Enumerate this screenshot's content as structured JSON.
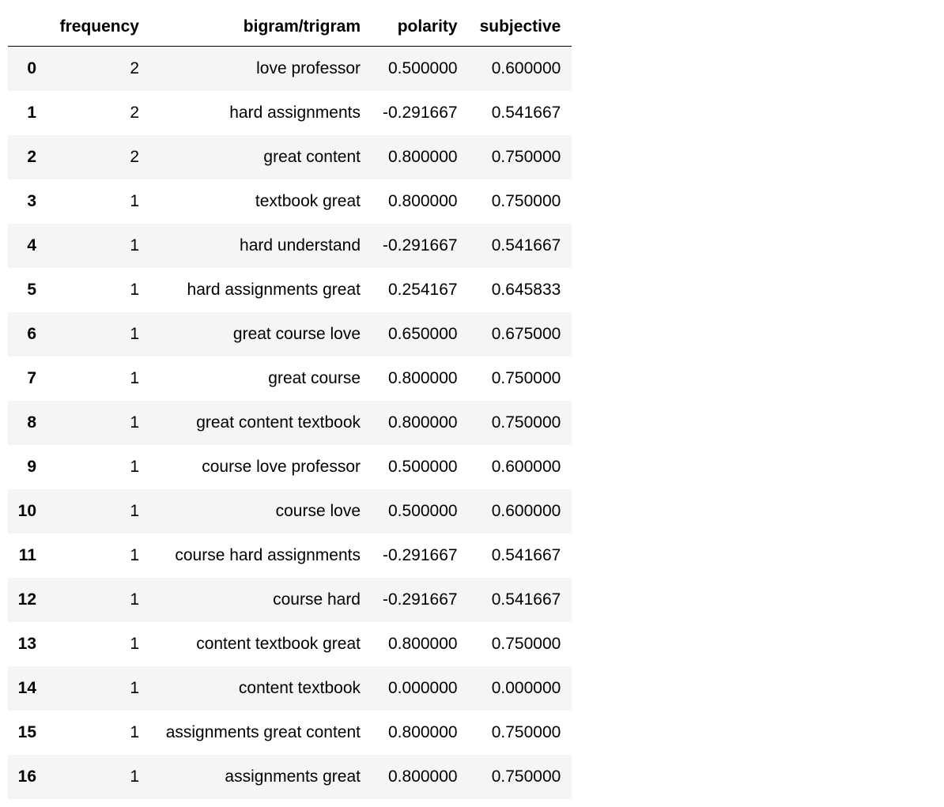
{
  "chart_data": {
    "type": "table",
    "columns": [
      "",
      "frequency",
      "bigram/trigram",
      "polarity",
      "subjective"
    ],
    "rows": [
      {
        "index": "0",
        "frequency": "2",
        "bigram": "love professor",
        "polarity": "0.500000",
        "subjective": "0.600000"
      },
      {
        "index": "1",
        "frequency": "2",
        "bigram": "hard assignments",
        "polarity": "-0.291667",
        "subjective": "0.541667"
      },
      {
        "index": "2",
        "frequency": "2",
        "bigram": "great content",
        "polarity": "0.800000",
        "subjective": "0.750000"
      },
      {
        "index": "3",
        "frequency": "1",
        "bigram": "textbook great",
        "polarity": "0.800000",
        "subjective": "0.750000"
      },
      {
        "index": "4",
        "frequency": "1",
        "bigram": "hard understand",
        "polarity": "-0.291667",
        "subjective": "0.541667"
      },
      {
        "index": "5",
        "frequency": "1",
        "bigram": "hard assignments great",
        "polarity": "0.254167",
        "subjective": "0.645833"
      },
      {
        "index": "6",
        "frequency": "1",
        "bigram": "great course love",
        "polarity": "0.650000",
        "subjective": "0.675000"
      },
      {
        "index": "7",
        "frequency": "1",
        "bigram": "great course",
        "polarity": "0.800000",
        "subjective": "0.750000"
      },
      {
        "index": "8",
        "frequency": "1",
        "bigram": "great content textbook",
        "polarity": "0.800000",
        "subjective": "0.750000"
      },
      {
        "index": "9",
        "frequency": "1",
        "bigram": "course love professor",
        "polarity": "0.500000",
        "subjective": "0.600000"
      },
      {
        "index": "10",
        "frequency": "1",
        "bigram": "course love",
        "polarity": "0.500000",
        "subjective": "0.600000"
      },
      {
        "index": "11",
        "frequency": "1",
        "bigram": "course hard assignments",
        "polarity": "-0.291667",
        "subjective": "0.541667"
      },
      {
        "index": "12",
        "frequency": "1",
        "bigram": "course hard",
        "polarity": "-0.291667",
        "subjective": "0.541667"
      },
      {
        "index": "13",
        "frequency": "1",
        "bigram": "content textbook great",
        "polarity": "0.800000",
        "subjective": "0.750000"
      },
      {
        "index": "14",
        "frequency": "1",
        "bigram": "content textbook",
        "polarity": "0.000000",
        "subjective": "0.000000"
      },
      {
        "index": "15",
        "frequency": "1",
        "bigram": "assignments great content",
        "polarity": "0.800000",
        "subjective": "0.750000"
      },
      {
        "index": "16",
        "frequency": "1",
        "bigram": "assignments great",
        "polarity": "0.800000",
        "subjective": "0.750000"
      }
    ]
  }
}
